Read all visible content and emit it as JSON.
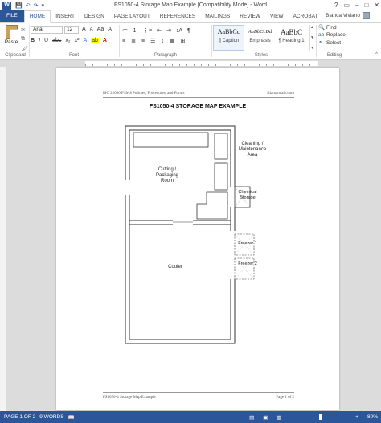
{
  "window": {
    "title": "FS1050-4 Storage Map Example [Compatibility Mode] - Word",
    "controls": [
      "?",
      "▭",
      "–",
      "□",
      "✕"
    ]
  },
  "qat": [
    "💾",
    "↶",
    "↷",
    "▾"
  ],
  "tabs": [
    "FILE",
    "HOME",
    "INSERT",
    "DESIGN",
    "PAGE LAYOUT",
    "REFERENCES",
    "MAILINGS",
    "REVIEW",
    "VIEW",
    "ACROBAT"
  ],
  "active_tab": "HOME",
  "user": {
    "name": "Bianca Viviano"
  },
  "ribbon": {
    "clipboard": {
      "paste_label": "Paste",
      "group": "Clipboard",
      "small_icons": [
        "✂",
        "⧉",
        "🖌"
      ]
    },
    "font": {
      "group": "Font",
      "font_name": "Arial",
      "font_size": "12",
      "grow": "A",
      "shrink": "A",
      "case": "Aa",
      "clear": "A",
      "bold": "B",
      "italic": "I",
      "underline": "U",
      "strike": "abc",
      "subscript": "x₂",
      "superscript": "x²",
      "effects": "A",
      "highlight": "ab",
      "color": "A"
    },
    "paragraph": {
      "group": "Paragraph",
      "row1": [
        "≔",
        "⒈",
        "⋮≡",
        "⇤",
        "⇥",
        "↕A",
        "¶"
      ],
      "row2": [
        "≡",
        "≣",
        "≡",
        "☰",
        "↕",
        "▦",
        "⊞"
      ]
    },
    "styles": {
      "group": "Styles",
      "items": [
        {
          "sample": "AaBbCc",
          "name": "¶ Caption"
        },
        {
          "sample": "AaBbCcDd",
          "name": "Emphasis"
        },
        {
          "sample": "AaBbC",
          "name": "¶ Heading 1"
        }
      ]
    },
    "editing": {
      "group": "Editing",
      "find": "Find",
      "replace": "Replace",
      "select": "Select"
    }
  },
  "document": {
    "header_left": "ISO 22000 FSMS Policies, Procedures, and Forms",
    "header_right": "Bizmanualz.com",
    "title": "FS1050-4 STORAGE MAP EXAMPLE",
    "footer_left": "FS1050-4 Storage Map Example",
    "footer_right": "Page 1 of 2",
    "map_labels": {
      "cleaning_1": "Cleaning /",
      "cleaning_2": "Maintenance",
      "cleaning_3": "Area",
      "cutting_1": "Cutting /",
      "cutting_2": "Packaging",
      "cutting_3": "Room",
      "chemical_1": "Chemical",
      "chemical_2": "Storage",
      "freezer1": "Freezer 1",
      "freezer2": "Freezer 2",
      "cooler": "Cooler"
    }
  },
  "status": {
    "page": "PAGE 1 OF 2",
    "words": "9 WORDS",
    "zoom": "80%",
    "zoom_minus": "–",
    "zoom_plus": "+"
  }
}
